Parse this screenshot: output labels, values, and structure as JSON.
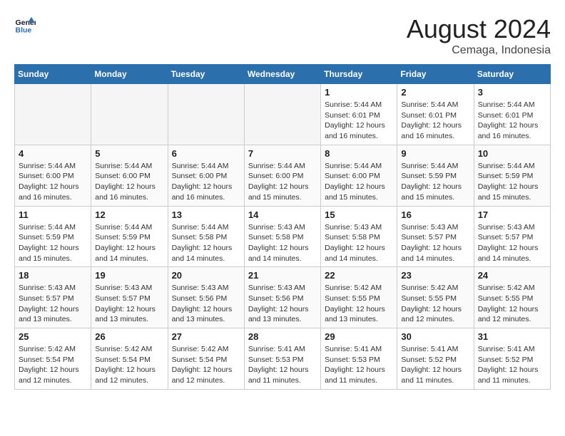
{
  "header": {
    "logo_line1": "General",
    "logo_line2": "Blue",
    "month_year": "August 2024",
    "location": "Cemaga, Indonesia"
  },
  "weekdays": [
    "Sunday",
    "Monday",
    "Tuesday",
    "Wednesday",
    "Thursday",
    "Friday",
    "Saturday"
  ],
  "weeks": [
    [
      {
        "day": "",
        "info": ""
      },
      {
        "day": "",
        "info": ""
      },
      {
        "day": "",
        "info": ""
      },
      {
        "day": "",
        "info": ""
      },
      {
        "day": "1",
        "info": "Sunrise: 5:44 AM\nSunset: 6:01 PM\nDaylight: 12 hours\nand 16 minutes."
      },
      {
        "day": "2",
        "info": "Sunrise: 5:44 AM\nSunset: 6:01 PM\nDaylight: 12 hours\nand 16 minutes."
      },
      {
        "day": "3",
        "info": "Sunrise: 5:44 AM\nSunset: 6:01 PM\nDaylight: 12 hours\nand 16 minutes."
      }
    ],
    [
      {
        "day": "4",
        "info": "Sunrise: 5:44 AM\nSunset: 6:00 PM\nDaylight: 12 hours\nand 16 minutes."
      },
      {
        "day": "5",
        "info": "Sunrise: 5:44 AM\nSunset: 6:00 PM\nDaylight: 12 hours\nand 16 minutes."
      },
      {
        "day": "6",
        "info": "Sunrise: 5:44 AM\nSunset: 6:00 PM\nDaylight: 12 hours\nand 16 minutes."
      },
      {
        "day": "7",
        "info": "Sunrise: 5:44 AM\nSunset: 6:00 PM\nDaylight: 12 hours\nand 15 minutes."
      },
      {
        "day": "8",
        "info": "Sunrise: 5:44 AM\nSunset: 6:00 PM\nDaylight: 12 hours\nand 15 minutes."
      },
      {
        "day": "9",
        "info": "Sunrise: 5:44 AM\nSunset: 5:59 PM\nDaylight: 12 hours\nand 15 minutes."
      },
      {
        "day": "10",
        "info": "Sunrise: 5:44 AM\nSunset: 5:59 PM\nDaylight: 12 hours\nand 15 minutes."
      }
    ],
    [
      {
        "day": "11",
        "info": "Sunrise: 5:44 AM\nSunset: 5:59 PM\nDaylight: 12 hours\nand 15 minutes."
      },
      {
        "day": "12",
        "info": "Sunrise: 5:44 AM\nSunset: 5:59 PM\nDaylight: 12 hours\nand 14 minutes."
      },
      {
        "day": "13",
        "info": "Sunrise: 5:44 AM\nSunset: 5:58 PM\nDaylight: 12 hours\nand 14 minutes."
      },
      {
        "day": "14",
        "info": "Sunrise: 5:43 AM\nSunset: 5:58 PM\nDaylight: 12 hours\nand 14 minutes."
      },
      {
        "day": "15",
        "info": "Sunrise: 5:43 AM\nSunset: 5:58 PM\nDaylight: 12 hours\nand 14 minutes."
      },
      {
        "day": "16",
        "info": "Sunrise: 5:43 AM\nSunset: 5:57 PM\nDaylight: 12 hours\nand 14 minutes."
      },
      {
        "day": "17",
        "info": "Sunrise: 5:43 AM\nSunset: 5:57 PM\nDaylight: 12 hours\nand 14 minutes."
      }
    ],
    [
      {
        "day": "18",
        "info": "Sunrise: 5:43 AM\nSunset: 5:57 PM\nDaylight: 12 hours\nand 13 minutes."
      },
      {
        "day": "19",
        "info": "Sunrise: 5:43 AM\nSunset: 5:57 PM\nDaylight: 12 hours\nand 13 minutes."
      },
      {
        "day": "20",
        "info": "Sunrise: 5:43 AM\nSunset: 5:56 PM\nDaylight: 12 hours\nand 13 minutes."
      },
      {
        "day": "21",
        "info": "Sunrise: 5:43 AM\nSunset: 5:56 PM\nDaylight: 12 hours\nand 13 minutes."
      },
      {
        "day": "22",
        "info": "Sunrise: 5:42 AM\nSunset: 5:55 PM\nDaylight: 12 hours\nand 13 minutes."
      },
      {
        "day": "23",
        "info": "Sunrise: 5:42 AM\nSunset: 5:55 PM\nDaylight: 12 hours\nand 12 minutes."
      },
      {
        "day": "24",
        "info": "Sunrise: 5:42 AM\nSunset: 5:55 PM\nDaylight: 12 hours\nand 12 minutes."
      }
    ],
    [
      {
        "day": "25",
        "info": "Sunrise: 5:42 AM\nSunset: 5:54 PM\nDaylight: 12 hours\nand 12 minutes."
      },
      {
        "day": "26",
        "info": "Sunrise: 5:42 AM\nSunset: 5:54 PM\nDaylight: 12 hours\nand 12 minutes."
      },
      {
        "day": "27",
        "info": "Sunrise: 5:42 AM\nSunset: 5:54 PM\nDaylight: 12 hours\nand 12 minutes."
      },
      {
        "day": "28",
        "info": "Sunrise: 5:41 AM\nSunset: 5:53 PM\nDaylight: 12 hours\nand 11 minutes."
      },
      {
        "day": "29",
        "info": "Sunrise: 5:41 AM\nSunset: 5:53 PM\nDaylight: 12 hours\nand 11 minutes."
      },
      {
        "day": "30",
        "info": "Sunrise: 5:41 AM\nSunset: 5:52 PM\nDaylight: 12 hours\nand 11 minutes."
      },
      {
        "day": "31",
        "info": "Sunrise: 5:41 AM\nSunset: 5:52 PM\nDaylight: 12 hours\nand 11 minutes."
      }
    ]
  ]
}
